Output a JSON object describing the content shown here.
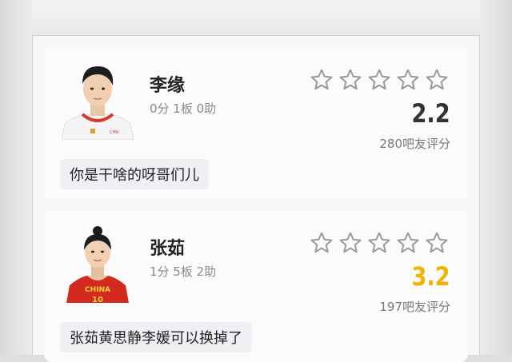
{
  "players": [
    {
      "name": "李缘",
      "stats": "0分 1板 0助",
      "score": "2.2",
      "score_color": "#333333",
      "rating_count": "280吧友评分",
      "stars_filled": 0,
      "stars_total": 5,
      "comment": "你是干啥的呀哥们儿"
    },
    {
      "name": "张茹",
      "stats": "1分 5板 2助",
      "score": "3.2",
      "score_color": "#f0b400",
      "rating_count": "197吧友评分",
      "stars_filled": 0,
      "stars_total": 5,
      "comment": "张茹黄思静李媛可以换掉了",
      "jersey_text": "CHINA"
    }
  ]
}
